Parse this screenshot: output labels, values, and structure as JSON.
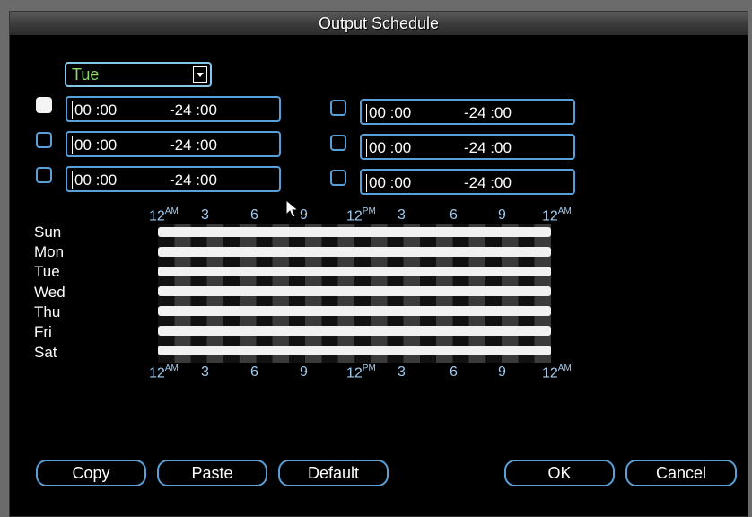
{
  "window": {
    "title": "Output Schedule"
  },
  "day_select": {
    "value": "Tue"
  },
  "periods": [
    {
      "enabled": true,
      "start": "00 :00",
      "end": "-24 :00"
    },
    {
      "enabled": false,
      "start": "00 :00",
      "end": "-24 :00"
    },
    {
      "enabled": false,
      "start": "00 :00",
      "end": "-24 :00"
    },
    {
      "enabled": false,
      "start": "00 :00",
      "end": "-24 :00"
    },
    {
      "enabled": false,
      "start": "00 :00",
      "end": "-24 :00"
    },
    {
      "enabled": false,
      "start": "00 :00",
      "end": "-24 :00"
    }
  ],
  "timeline": {
    "days": [
      "Sun",
      "Mon",
      "Tue",
      "Wed",
      "Thu",
      "Fri",
      "Sat"
    ],
    "ticks": [
      {
        "n": "12",
        "s": "AM"
      },
      {
        "n": "3",
        "s": ""
      },
      {
        "n": "6",
        "s": ""
      },
      {
        "n": "9",
        "s": ""
      },
      {
        "n": "12",
        "s": "PM"
      },
      {
        "n": "3",
        "s": ""
      },
      {
        "n": "6",
        "s": ""
      },
      {
        "n": "9",
        "s": ""
      },
      {
        "n": "12",
        "s": "AM"
      }
    ]
  },
  "buttons": {
    "copy": "Copy",
    "paste": "Paste",
    "default": "Default",
    "ok": "OK",
    "cancel": "Cancel"
  },
  "colors": {
    "accent": "#5aa0d8",
    "selected_text": "#8bd96b",
    "tick_text": "#9ecbf0"
  }
}
